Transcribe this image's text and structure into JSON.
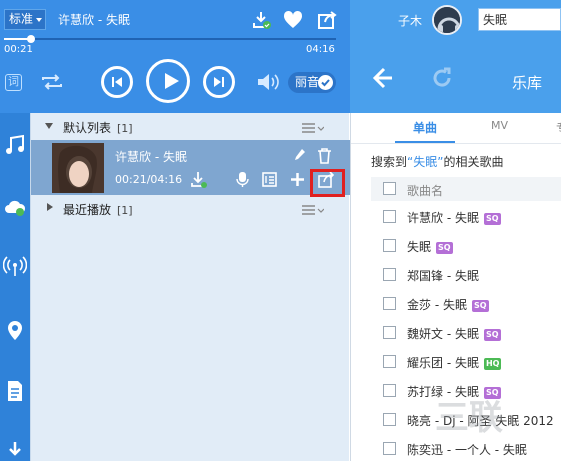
{
  "player": {
    "quality_select": "标准",
    "now_playing": "许慧欣 - 失眠",
    "time_elapsed": "00:21",
    "time_total": "04:16",
    "progress_fraction": 0.082,
    "lyric_icon_text": "词",
    "quality_badge": "丽音"
  },
  "user": {
    "name": "子木",
    "search_value": "失眠"
  },
  "nav": {
    "library_label": "乐库"
  },
  "playlist": {
    "default_group": {
      "name": "默认列表",
      "count": "[1]"
    },
    "recent_group": {
      "name": "最近播放",
      "count": "[1]"
    },
    "song": {
      "title": "许慧欣 - 失眠",
      "time": "00:21/04:16"
    }
  },
  "results": {
    "tabs": [
      "单曲",
      "MV",
      "专"
    ],
    "summary_prefix": "搜索到",
    "summary_keyword": "“失眠”",
    "summary_suffix": "的相关歌曲",
    "column_header": "歌曲名",
    "rows": [
      {
        "name": "许慧欣 - 失眠",
        "badge": "SQ"
      },
      {
        "name": "失眠",
        "badge": "SQ"
      },
      {
        "name": "郑国锋 - 失眠",
        "badge": ""
      },
      {
        "name": "金莎 - 失眠",
        "badge": "SQ"
      },
      {
        "name": "魏妍文 - 失眠",
        "badge": "SQ"
      },
      {
        "name": "耀乐团 - 失眠",
        "badge": "HQ"
      },
      {
        "name": "苏打绿 - 失眠",
        "badge": "SQ"
      },
      {
        "name": "晓亮 - Dj - 阿圣 失眠 2012",
        "badge": ""
      },
      {
        "name": "陈奕迅 - 一个人 - 失眠",
        "badge": ""
      }
    ]
  },
  "colors": {
    "accent": "#3a8ee6",
    "highlight_box": "#e02020",
    "badge_sq": "#b46fd6",
    "badge_hq": "#4cba55"
  }
}
